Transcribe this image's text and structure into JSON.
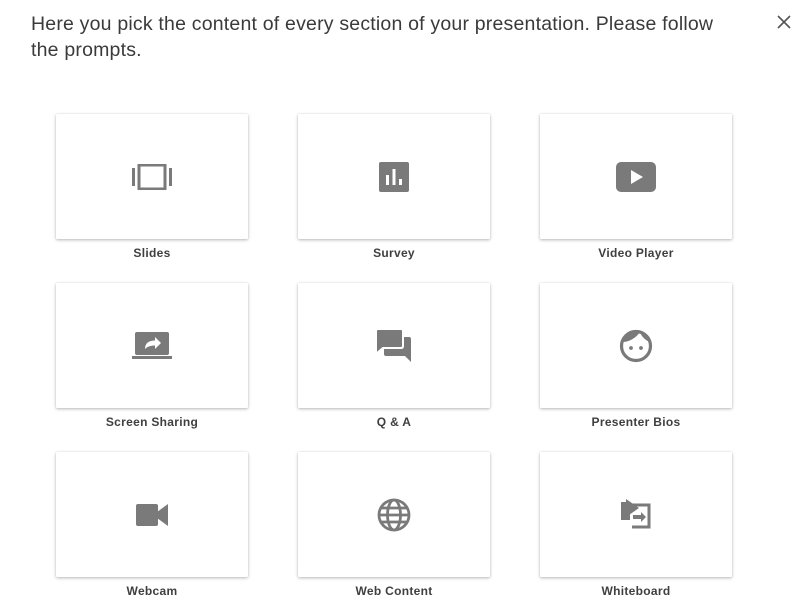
{
  "dialog": {
    "intro_text": "Here you pick the content of every section of your presentation. Please follow the prompts.",
    "close_icon": "close-icon",
    "icon_color": "#7a7a7a"
  },
  "tiles": [
    {
      "label": "Slides",
      "icon": "slides-icon"
    },
    {
      "label": "Survey",
      "icon": "poll-chart-icon"
    },
    {
      "label": "Video Player",
      "icon": "play-icon"
    },
    {
      "label": "Screen Sharing",
      "icon": "screen-share-icon"
    },
    {
      "label": "Q & A",
      "icon": "chat-bubbles-icon"
    },
    {
      "label": "Presenter Bios",
      "icon": "face-icon"
    },
    {
      "label": "Webcam",
      "icon": "video-camera-icon"
    },
    {
      "label": "Web Content",
      "icon": "globe-icon"
    },
    {
      "label": "Whiteboard",
      "icon": "whiteboard-icon"
    }
  ]
}
